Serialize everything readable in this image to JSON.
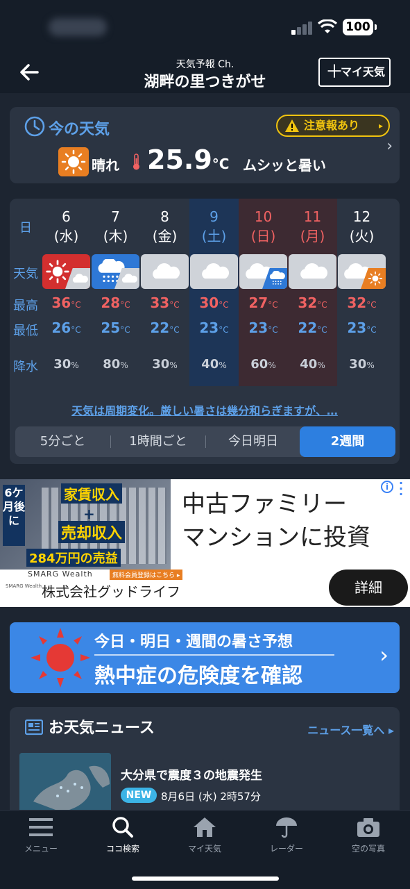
{
  "header": {
    "sub": "天気予報 Ch.",
    "title": "湖畔の里つきがせ",
    "my_weather_label": "マイ天気"
  },
  "now": {
    "title": "今の天気",
    "caution": "注意報あり",
    "condition": "晴れ",
    "temp": "25.9",
    "temp_unit": "°C",
    "feel": "ムシッと暑い"
  },
  "forecast": {
    "labels": {
      "day": "日",
      "weather": "天気",
      "high": "最高",
      "low": "最低",
      "precip": "降水"
    },
    "days": [
      {
        "num": "6",
        "dow": "(水)",
        "hi": "36",
        "lo": "26",
        "pr": "30",
        "icon_main": "sunny",
        "icon_sub": "cloudy"
      },
      {
        "num": "7",
        "dow": "(木)",
        "hi": "28",
        "lo": "25",
        "pr": "80",
        "icon_main": "rain",
        "icon_sub": "cloudy"
      },
      {
        "num": "8",
        "dow": "(金)",
        "hi": "33",
        "lo": "22",
        "pr": "30",
        "icon_main": "cloudy",
        "icon_sub": ""
      },
      {
        "num": "9",
        "dow": "(土)",
        "hi": "30",
        "lo": "23",
        "pr": "40",
        "icon_main": "cloudy",
        "icon_sub": ""
      },
      {
        "num": "10",
        "dow": "(日)",
        "hi": "27",
        "lo": "23",
        "pr": "60",
        "icon_main": "cloudy",
        "icon_sub": "rain"
      },
      {
        "num": "11",
        "dow": "(月)",
        "hi": "32",
        "lo": "22",
        "pr": "40",
        "icon_main": "cloudy",
        "icon_sub": ""
      },
      {
        "num": "12",
        "dow": "(火)",
        "hi": "32",
        "lo": "23",
        "pr": "30",
        "icon_main": "cloudy",
        "icon_sub": "sunny"
      }
    ],
    "unit_temp": "°C",
    "unit_precip": "%",
    "summary_link": "天気は周期変化。厳しい暑さは幾分和らぎますが、…",
    "tabs": [
      "5分ごと",
      "1時間ごと",
      "今日明日",
      "2週間"
    ]
  },
  "ad": {
    "badge": "6ケ月後に",
    "line1": "家賃収入",
    "plus": "+",
    "line2": "売却収入",
    "amount": "284万円の売益",
    "brand": "SMARG Wealth",
    "cta_small": "無料会員登録はこちら ▸",
    "headline1": "中古ファミリー",
    "headline2": "マンションに投資",
    "foot_brand": "SMARG Wealth",
    "company": "株式会社グッドライフ",
    "detail": "詳細"
  },
  "heat": {
    "line1": "今日・明日・週間の暑さ予想",
    "line2": "熱中症の危険度を確認"
  },
  "news": {
    "title": "お天気ニュース",
    "more": "ニュース一覧へ",
    "item_title": "大分県で震度３の地震発生",
    "badge": "NEW",
    "date": "8月6日 (水) 2時57分"
  },
  "nav": [
    "メニュー",
    "ココ検索",
    "マイ天気",
    "レーダー",
    "空の写真"
  ],
  "status": {
    "battery": "100"
  }
}
